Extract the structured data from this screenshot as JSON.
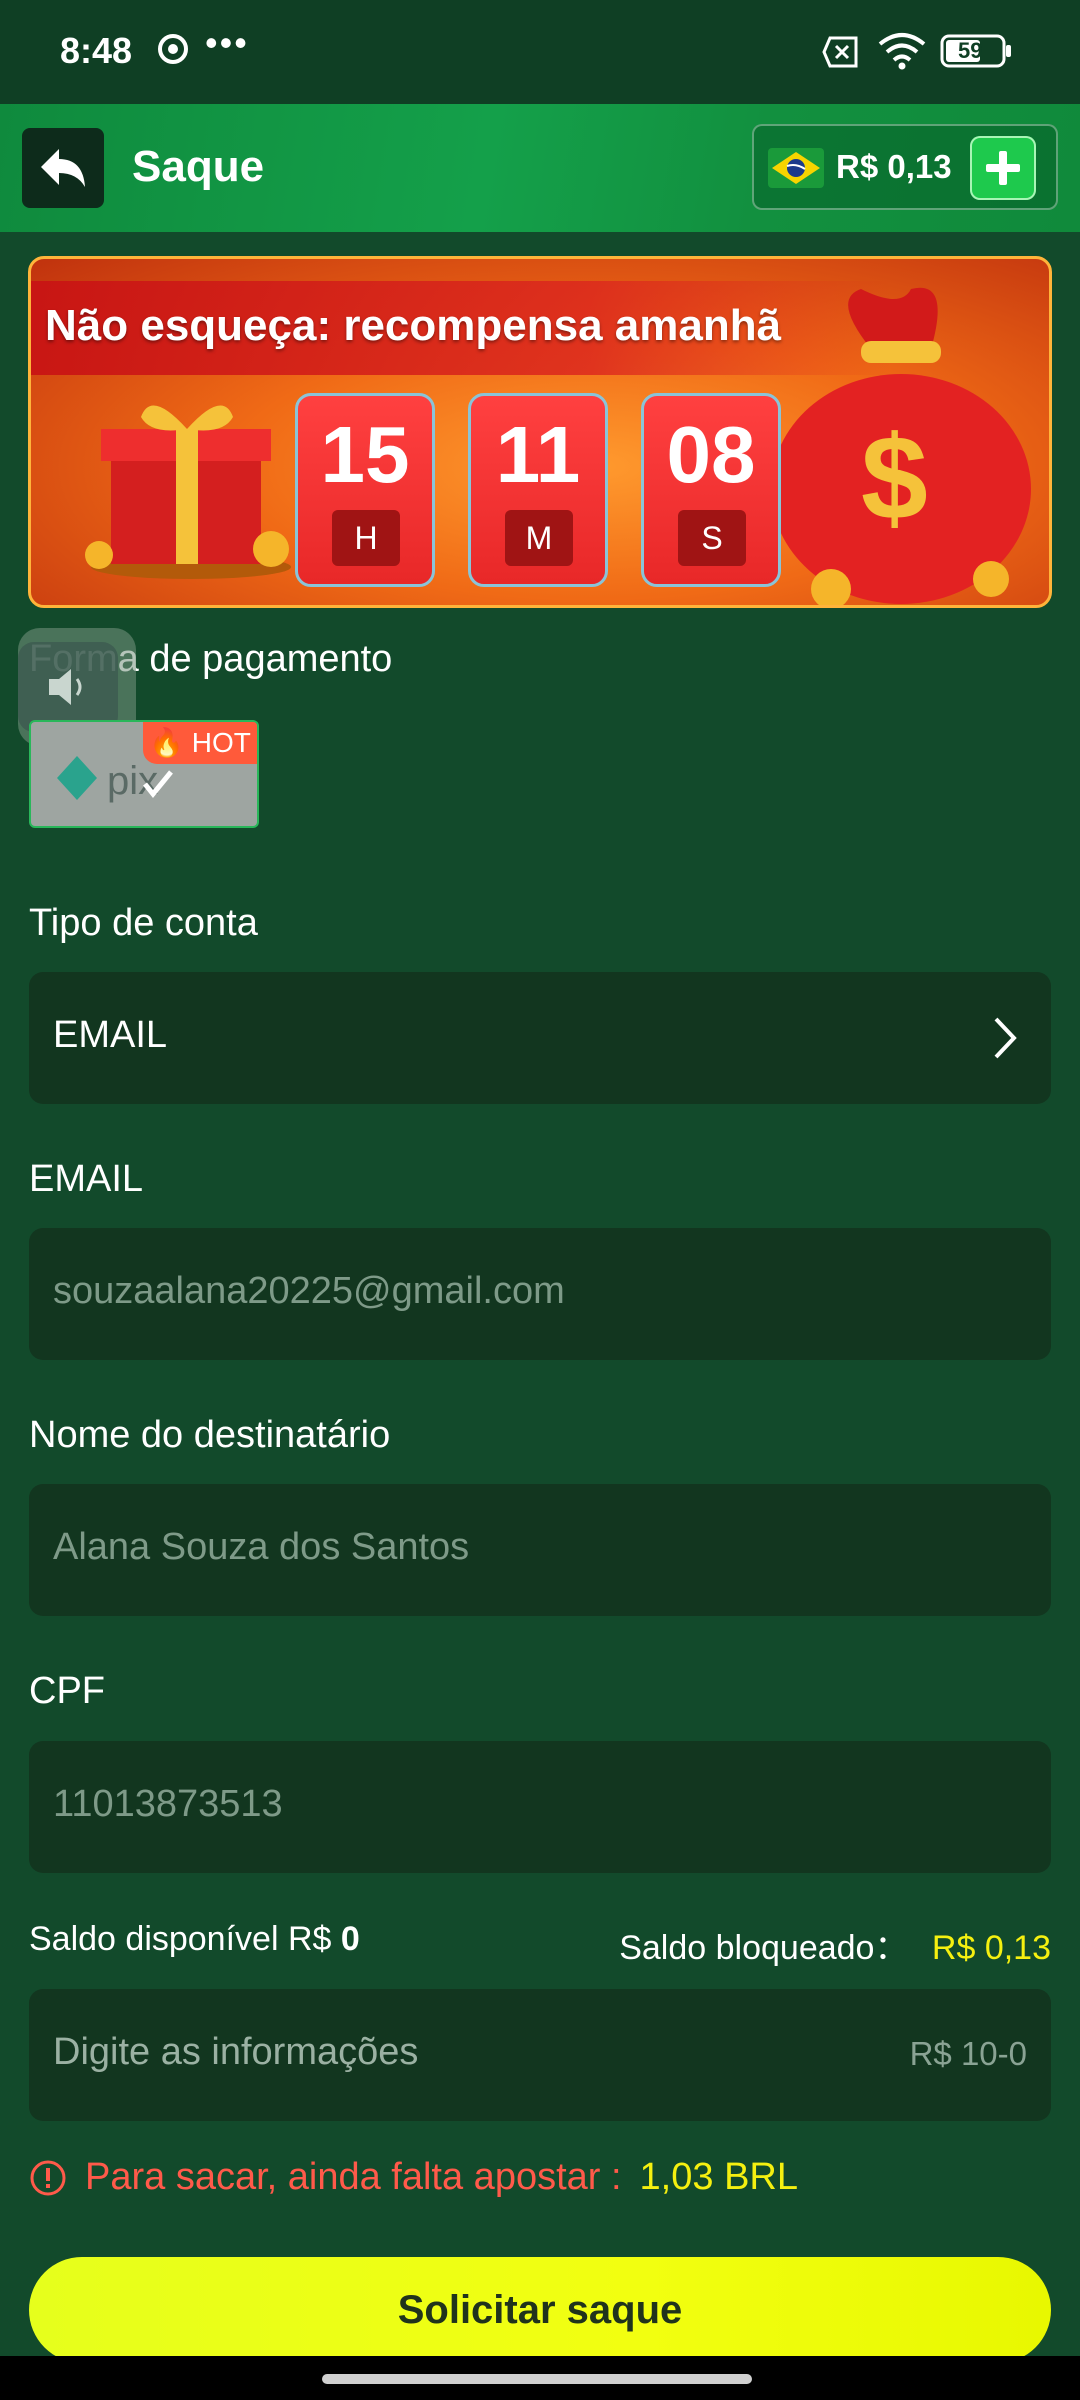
{
  "status_bar": {
    "time": "8:48",
    "dots": "•••",
    "battery": "59"
  },
  "header": {
    "title": "Saque",
    "balance": "R$ 0,13",
    "back_icon": "back-arrow-icon",
    "add_icon": "plus-icon"
  },
  "banner": {
    "text": "Não esqueça: recompensa amanhã",
    "timer": [
      {
        "value": "15",
        "unit": "H"
      },
      {
        "value": "11",
        "unit": "M"
      },
      {
        "value": "08",
        "unit": "S"
      }
    ]
  },
  "payment": {
    "label": "Forma de pagamento",
    "method": "pix",
    "hot_tag": "HOT"
  },
  "account_type": {
    "label": "Tipo de conta",
    "value": "EMAIL"
  },
  "email": {
    "label": "EMAIL",
    "value": "souzaalana20225@gmail.com"
  },
  "recipient": {
    "label": "Nome do destinatário",
    "value": "Alana Souza dos Santos"
  },
  "cpf": {
    "label": "CPF",
    "value": "11013873513"
  },
  "balances": {
    "available_label": "Saldo disponível R$",
    "available_value": "0",
    "blocked_label": "Saldo bloqueado：",
    "blocked_value": "R$ 0,13"
  },
  "amount": {
    "placeholder": "Digite as informações",
    "range": "R$ 10-0"
  },
  "warning": {
    "text": "Para sacar, ainda falta apostar :",
    "amount": "1,03 BRL"
  },
  "submit_label": "Solicitar saque",
  "colors": {
    "background": "#124a2b",
    "header": "#14a04a",
    "accent_yellow": "#f5f010",
    "warning_red": "#ff5a4a",
    "button": "#eaff14"
  }
}
